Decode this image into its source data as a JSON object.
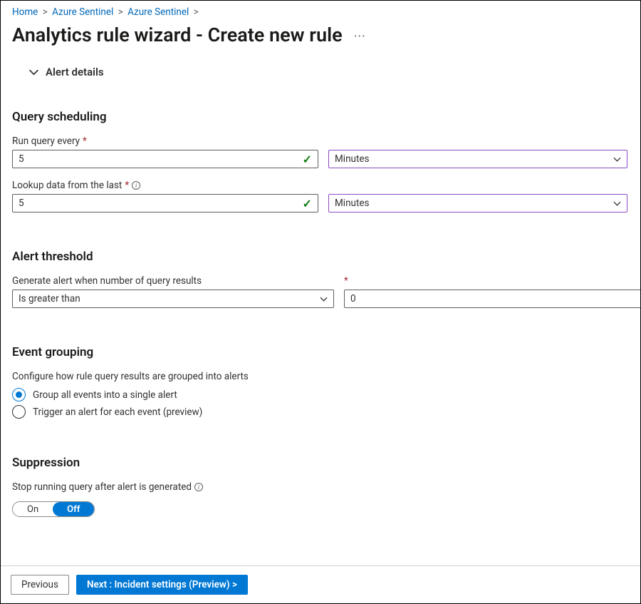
{
  "breadcrumb": {
    "home": "Home",
    "item1": "Azure Sentinel",
    "item2": "Azure Sentinel"
  },
  "page": {
    "title": "Analytics rule wizard - Create new rule",
    "more": "···"
  },
  "alert_details": {
    "label": "Alert details"
  },
  "query_scheduling": {
    "title": "Query scheduling",
    "run_query_label": "Run query every",
    "run_query_value": "5",
    "run_query_unit": "Minutes",
    "lookup_label": "Lookup data from the last",
    "lookup_value": "5",
    "lookup_unit": "Minutes"
  },
  "alert_threshold": {
    "title": "Alert threshold",
    "label": "Generate alert when number of query results",
    "operator": "Is greater than",
    "value": "0"
  },
  "event_grouping": {
    "title": "Event grouping",
    "desc": "Configure how rule query results are grouped into alerts",
    "opt1": "Group all events into a single alert",
    "opt2": "Trigger an alert for each event (preview)"
  },
  "suppression": {
    "title": "Suppression",
    "desc": "Stop running query after alert is generated",
    "on": "On",
    "off": "Off"
  },
  "footer": {
    "previous": "Previous",
    "next": "Next : Incident settings (Preview) >"
  }
}
